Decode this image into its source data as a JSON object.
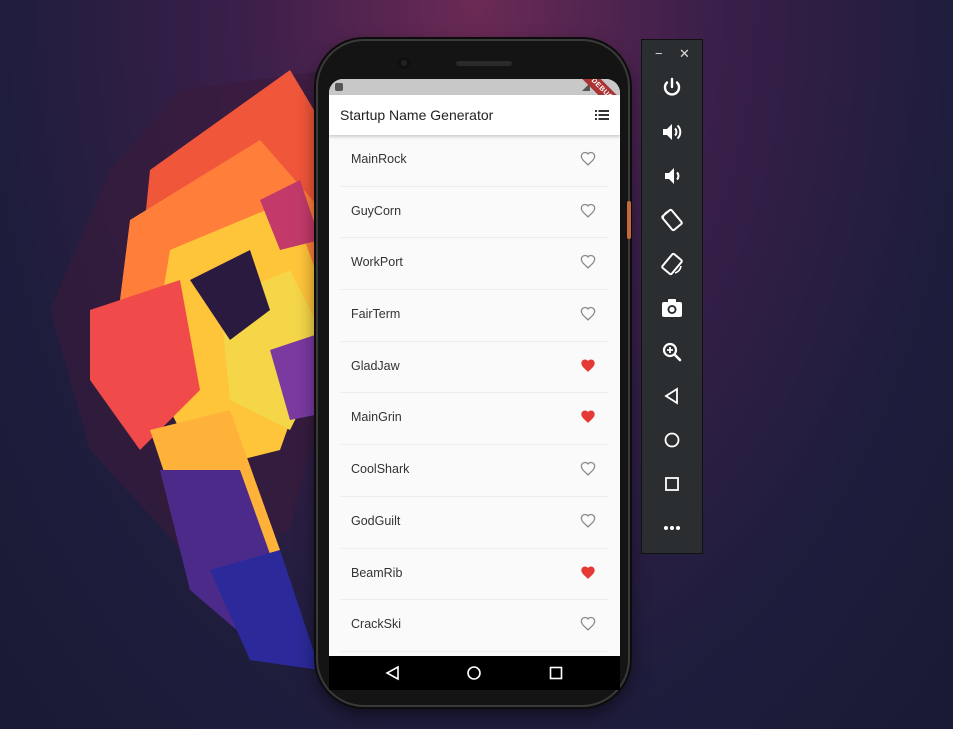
{
  "app": {
    "title": "Startup Name Generator",
    "debug_banner": "DEBUG"
  },
  "names": [
    {
      "label": "MainRock",
      "saved": false
    },
    {
      "label": "GuyCorn",
      "saved": false
    },
    {
      "label": "WorkPort",
      "saved": false
    },
    {
      "label": "FairTerm",
      "saved": false
    },
    {
      "label": "GladJaw",
      "saved": true
    },
    {
      "label": "MainGrin",
      "saved": true
    },
    {
      "label": "CoolShark",
      "saved": false
    },
    {
      "label": "GodGuilt",
      "saved": false
    },
    {
      "label": "BeamRib",
      "saved": true
    },
    {
      "label": "CrackSki",
      "saved": false
    }
  ],
  "colors": {
    "heart_saved": "#e53935",
    "heart_outline": "#8a8a8a"
  },
  "emulator_toolbar": {
    "minimize": "−",
    "close": "✕"
  }
}
